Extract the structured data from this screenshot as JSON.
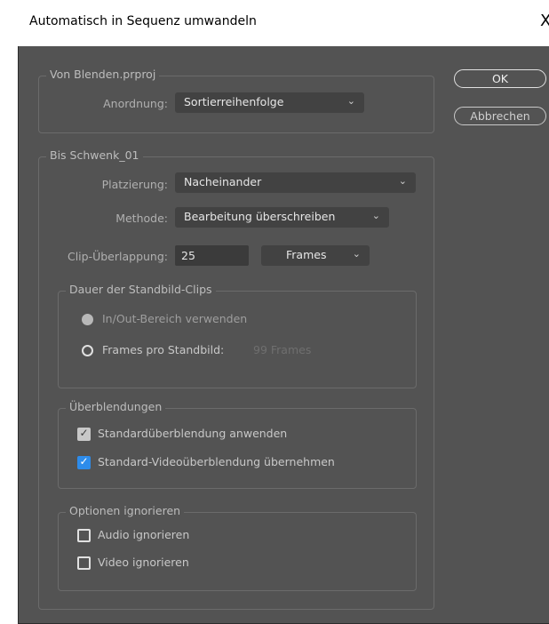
{
  "window": {
    "title": "Automatisch in Sequenz umwandeln",
    "close_glyph": "X"
  },
  "buttons": {
    "ok": "OK",
    "cancel": "Abbrechen"
  },
  "from_group": {
    "legend": "Von Blenden.prproj",
    "order_label": "Anordnung:",
    "order_value": "Sortierreihenfolge"
  },
  "to_group": {
    "legend": "Bis Schwenk_01",
    "placement_label": "Platzierung:",
    "placement_value": "Nacheinander",
    "method_label": "Methode:",
    "method_value": "Bearbeitung überschreiben",
    "overlap_label": "Clip-Überlappung:",
    "overlap_value": "25",
    "overlap_unit": "Frames"
  },
  "still_duration": {
    "legend": "Dauer der Standbild-Clips",
    "option_inout": "In/Out-Bereich verwenden",
    "option_frames": "Frames pro Standbild:",
    "frames_value": "99 Frames",
    "selected": "In/Out-Bereich verwenden"
  },
  "transitions": {
    "legend": "Überblendungen",
    "audio_default": "Standardüberblendung anwenden",
    "audio_default_checked": true,
    "video_default": "Standard-Videoüberblendung übernehmen",
    "video_default_checked": true
  },
  "ignore": {
    "legend": "Optionen ignorieren",
    "audio": "Audio ignorieren",
    "audio_checked": false,
    "video": "Video ignorieren",
    "video_checked": false
  },
  "icons": {
    "chevron": "chevron-down-icon",
    "check": "checkmark-icon"
  },
  "colors": {
    "panel": "#535353",
    "accent": "#2d8ceb",
    "field": "#424242"
  }
}
